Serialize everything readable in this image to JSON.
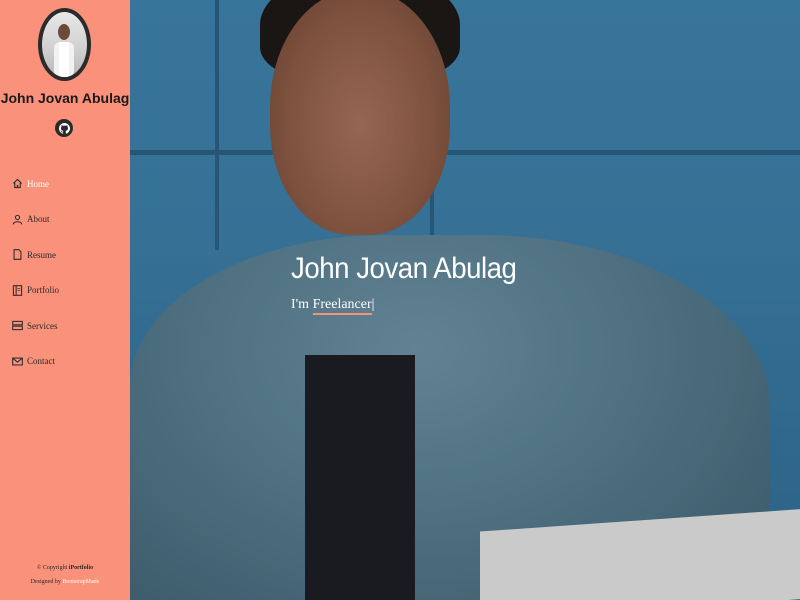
{
  "profile": {
    "name": "John Jovan Abulag"
  },
  "social": {
    "icon": "github-icon"
  },
  "nav": [
    {
      "label": "Home",
      "icon": "home-icon",
      "active": true
    },
    {
      "label": "About",
      "icon": "user-icon",
      "active": false
    },
    {
      "label": "Resume",
      "icon": "file-icon",
      "active": false
    },
    {
      "label": "Portfolio",
      "icon": "book-icon",
      "active": false
    },
    {
      "label": "Services",
      "icon": "server-icon",
      "active": false
    },
    {
      "label": "Contact",
      "icon": "envelope-icon",
      "active": false
    }
  ],
  "footer": {
    "copyright_prefix": "© Copyright ",
    "brand": "iPortfolio",
    "designed_prefix": "Designed by ",
    "designer": "BootstrapMade"
  },
  "hero": {
    "title": "John Jovan Abulag",
    "prefix": "I'm ",
    "typed": "Freelancer",
    "cursor": "|"
  },
  "colors": {
    "sidebar": "#fa917a",
    "accent": "#fa917a"
  }
}
